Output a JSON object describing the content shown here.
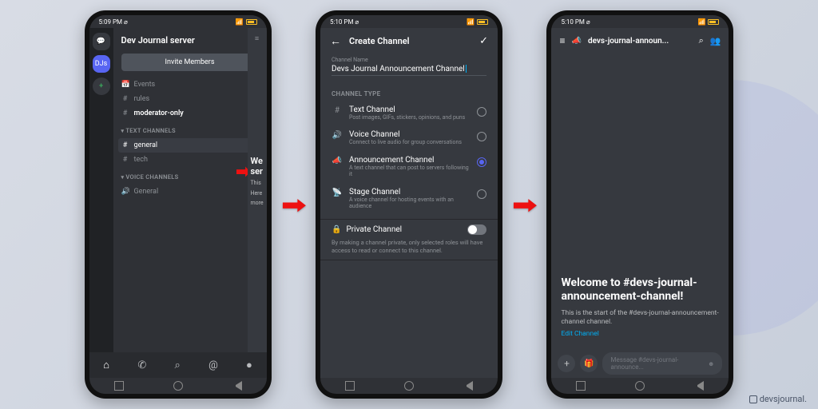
{
  "status": {
    "time1": "5:09 PM ⌀",
    "time2": "5:10 PM ⌀",
    "time3": "5:10 PM ⌀",
    "net": "📶",
    "sig": "✦‍ ⬚ "
  },
  "phone1": {
    "guild_initials": "DJs",
    "server_name": "Dev Journal server",
    "invite_btn": "Invite Members",
    "items_top": [
      {
        "icon": "📅",
        "label": "Events"
      },
      {
        "icon": "#",
        "label": "rules"
      },
      {
        "icon": "#",
        "label": "moderator-only",
        "bold": true
      }
    ],
    "cat1": "TEXT CHANNELS",
    "text_channels": [
      {
        "icon": "#",
        "label": "general",
        "active": true
      },
      {
        "icon": "#",
        "label": "tech"
      }
    ],
    "cat2": "VOICE CHANNELS",
    "voice_channels": [
      {
        "icon": "🔊",
        "label": "General"
      }
    ],
    "peek_title1": "We",
    "peek_title2": "ser",
    "peek_line1": "This",
    "peek_line2": "Here",
    "peek_line3": "more"
  },
  "phone2": {
    "title": "Create Channel",
    "field_label": "Channel Name",
    "field_value": "Devs Journal Announcement Channel",
    "section": "CHANNEL TYPE",
    "types": [
      {
        "icon": "#",
        "name": "Text Channel",
        "desc": "Post images, GIFs, stickers, opinions, and puns",
        "sel": false
      },
      {
        "icon": "🔊",
        "name": "Voice Channel",
        "desc": "Connect to live audio for group conversations",
        "sel": false
      },
      {
        "icon": "📣",
        "name": "Announcement Channel",
        "desc": "A text channel that can post to servers following it",
        "sel": true
      },
      {
        "icon": "📡",
        "name": "Stage Channel",
        "desc": "A voice channel for hosting events with an audience",
        "sel": false
      }
    ],
    "private_label": "Private Channel",
    "private_icon": "🔒",
    "private_desc": "By making a channel private, only selected roles will have access to read or connect to this channel."
  },
  "phone3": {
    "header_title": "devs-journal-announ...",
    "welcome": "Welcome to #devs-journal-announcement-channel!",
    "start": "This is the start of the #devs-journal-announcement-channel channel.",
    "edit": "Edit Channel",
    "msg_placeholder": "Message #devs-journal-announce..."
  },
  "watermark": "devsjournal."
}
